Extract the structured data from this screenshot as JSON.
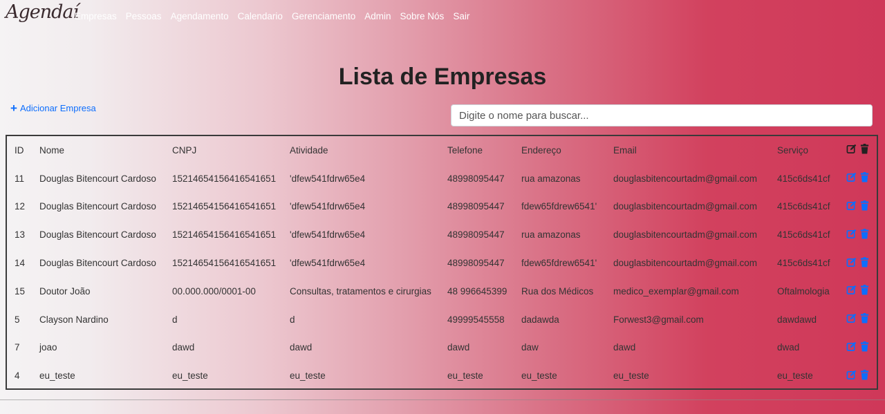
{
  "brand": "Agendaí",
  "nav": [
    "Empresas",
    "Pessoas",
    "Agendamento",
    "Calendario",
    "Gerenciamento",
    "Admin",
    "Sobre Nós",
    "Sair"
  ],
  "page_title": "Lista de Empresas",
  "add_button": "Adicionar Empresa",
  "search": {
    "placeholder": "Digite o nome para buscar..."
  },
  "colors": {
    "link": "#0d6efd",
    "header_icon": "#222222",
    "gradient_end": "#cf3859"
  },
  "table": {
    "headers": [
      "ID",
      "Nome",
      "CNPJ",
      "Atividade",
      "Telefone",
      "Endereço",
      "Email",
      "Serviço"
    ],
    "rows": [
      [
        "11",
        "Douglas Bitencourt Cardoso",
        "15214654156416541651",
        "'dfew541fdrw65e4",
        "48998095447",
        "rua amazonas",
        "douglasbitencourtadm@gmail.com",
        "415c6ds41cf"
      ],
      [
        "12",
        "Douglas Bitencourt Cardoso",
        "15214654156416541651",
        "'dfew541fdrw65e4",
        "48998095447",
        "fdew65fdrew6541'",
        "douglasbitencourtadm@gmail.com",
        "415c6ds41cf"
      ],
      [
        "13",
        "Douglas Bitencourt Cardoso",
        "15214654156416541651",
        "'dfew541fdrw65e4",
        "48998095447",
        "rua amazonas",
        "douglasbitencourtadm@gmail.com",
        "415c6ds41cf"
      ],
      [
        "14",
        "Douglas Bitencourt Cardoso",
        "15214654156416541651",
        "'dfew541fdrw65e4",
        "48998095447",
        "fdew65fdrew6541'",
        "douglasbitencourtadm@gmail.com",
        "415c6ds41cf"
      ],
      [
        "15",
        "Doutor João",
        "00.000.000/0001-00",
        "Consultas, tratamentos e cirurgias",
        "48 996645399",
        "Rua dos Médicos",
        "medico_exemplar@gmail.com",
        "Oftalmologia"
      ],
      [
        "5",
        "Clayson Nardino",
        "d",
        "d",
        "49999545558",
        "dadawda",
        "Forwest3@gmail.com",
        "dawdawd"
      ],
      [
        "7",
        "joao",
        "dawd",
        "dawd",
        "dawd",
        "daw",
        "dawd",
        "dwad"
      ],
      [
        "4",
        "eu_teste",
        "eu_teste",
        "eu_teste",
        "eu_teste",
        "eu_teste",
        "eu_teste",
        "eu_teste"
      ]
    ]
  }
}
